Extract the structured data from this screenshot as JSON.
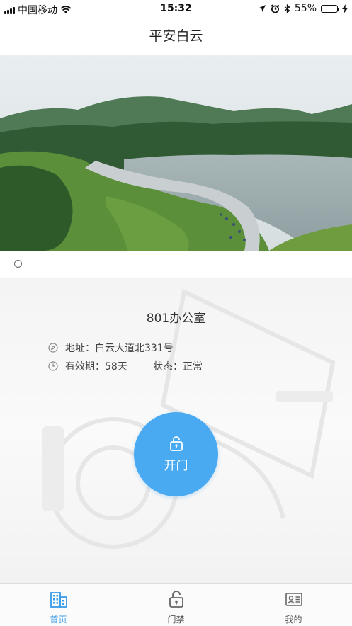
{
  "status_bar": {
    "carrier": "中国移动",
    "time": "15:32",
    "battery_percent": "55%",
    "battery_level": 0.55,
    "icons": [
      "signal-icon",
      "wifi-icon",
      "location-icon",
      "alarm-icon",
      "bluetooth-icon",
      "battery-icon",
      "charging-icon"
    ]
  },
  "header": {
    "title": "平安白云"
  },
  "banner": {
    "image": "lake-landscape-with-runners",
    "carousel_dots": 1
  },
  "door": {
    "room_name": "801办公室",
    "address_label": "地址：",
    "address_value": "白云大道北331号",
    "validity_label": "有效期：",
    "validity_value": "58天",
    "status_label": "状态：",
    "status_value": "正常",
    "open_button_label": "开门"
  },
  "tabs": [
    {
      "label": "首页",
      "icon": "building-icon",
      "active": true
    },
    {
      "label": "门禁",
      "icon": "lock-icon",
      "active": false
    },
    {
      "label": "我的",
      "icon": "id-card-icon",
      "active": false
    }
  ],
  "colors": {
    "accent": "#49aaf2",
    "tab_active": "#3a9be8",
    "battery": "#4cd964"
  }
}
